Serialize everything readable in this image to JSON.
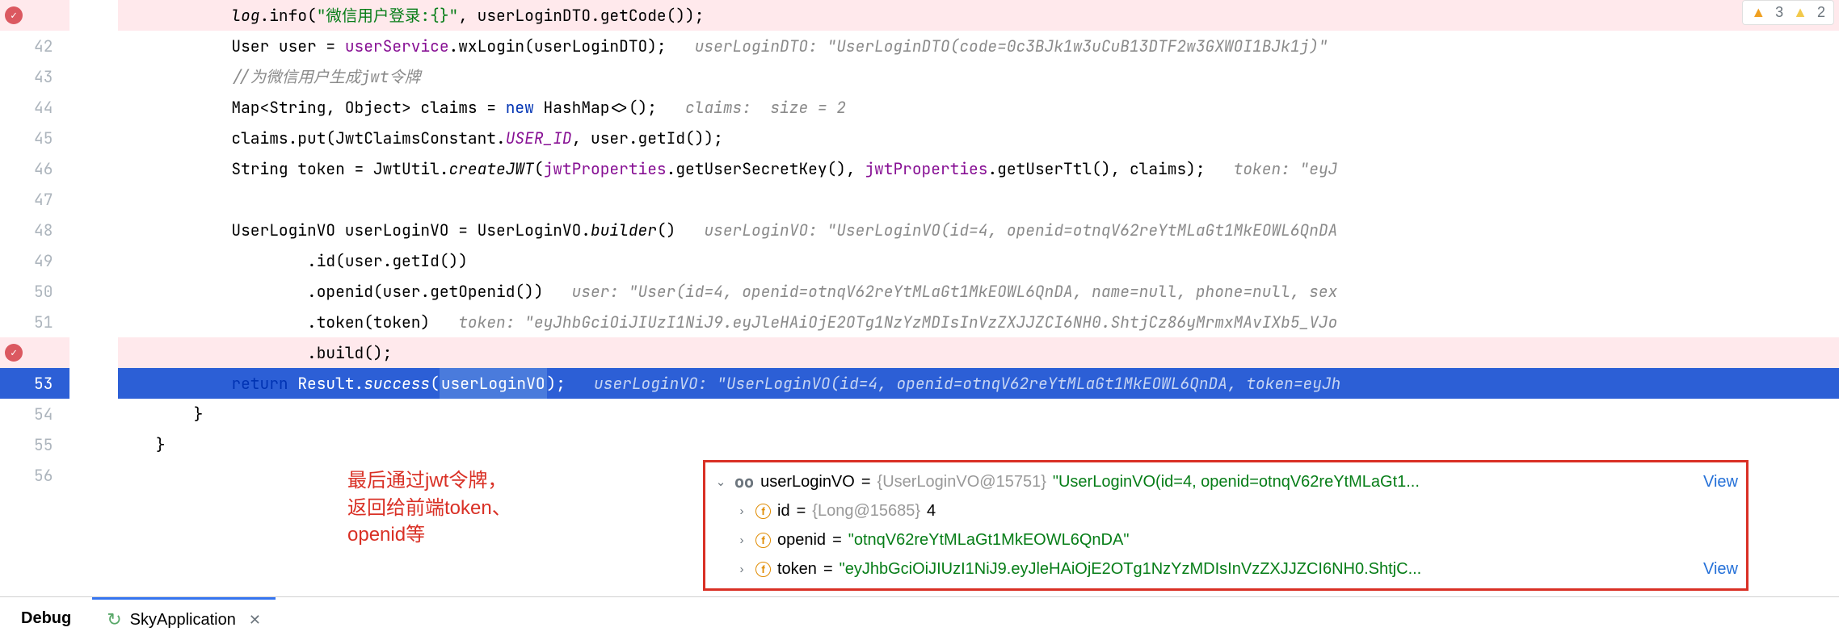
{
  "inspections": {
    "warn_count": "3",
    "weak_count": "2"
  },
  "lines": [
    {
      "num": "",
      "icon": "breakpoint",
      "indent": "            ",
      "tokens": [
        {
          "cls": "log-italic",
          "t": "log"
        },
        {
          "t": ".info("
        },
        {
          "cls": "str",
          "t": "\"微信用户登录:{}\""
        },
        {
          "t": ", userLoginDTO.getCode());"
        }
      ]
    },
    {
      "num": "42",
      "indent": "            ",
      "tokens": [
        {
          "t": "User user = "
        },
        {
          "cls": "field",
          "t": "userService"
        },
        {
          "t": ".wxLogin(userLoginDTO);   "
        },
        {
          "cls": "hint",
          "t": "userLoginDTO: \"UserLoginDTO(code=0c3BJk1w3uCuB13DTF2w3GXWOI1BJk1j)\""
        }
      ]
    },
    {
      "num": "43",
      "indent": "            ",
      "tokens": [
        {
          "cls": "comment",
          "t": "//为微信用户生成jwt令牌"
        }
      ]
    },
    {
      "num": "44",
      "indent": "            ",
      "tokens": [
        {
          "t": "Map<String, Object> claims = "
        },
        {
          "cls": "kw",
          "t": "new "
        },
        {
          "t": "HashMap<>();   "
        },
        {
          "cls": "hint",
          "t": "claims:  size = 2"
        }
      ]
    },
    {
      "num": "45",
      "indent": "            ",
      "tokens": [
        {
          "t": "claims.put(JwtClaimsConstant."
        },
        {
          "cls": "field method-static",
          "t": "USER_ID"
        },
        {
          "t": ", user.getId());"
        }
      ]
    },
    {
      "num": "46",
      "indent": "            ",
      "tokens": [
        {
          "t": "String token = JwtUtil."
        },
        {
          "cls": "method-static",
          "t": "createJWT"
        },
        {
          "t": "("
        },
        {
          "cls": "field",
          "t": "jwtProperties"
        },
        {
          "t": ".getUserSecretKey(), "
        },
        {
          "cls": "field",
          "t": "jwtProperties"
        },
        {
          "t": ".getUserTtl(), claims);   "
        },
        {
          "cls": "hint",
          "t": "token: \"eyJ"
        }
      ]
    },
    {
      "num": "47",
      "indent": "",
      "tokens": [
        {
          "t": ""
        }
      ]
    },
    {
      "num": "48",
      "indent": "            ",
      "tokens": [
        {
          "t": "UserLoginVO userLoginVO = UserLoginVO."
        },
        {
          "cls": "method-static",
          "t": "builder"
        },
        {
          "t": "()   "
        },
        {
          "cls": "hint",
          "t": "userLoginVO: \"UserLoginVO(id=4, openid=otnqV62reYtMLaGt1MkEOWL6QnDA"
        }
      ]
    },
    {
      "num": "49",
      "indent": "                    ",
      "tokens": [
        {
          "t": ".id(user.getId())"
        }
      ]
    },
    {
      "num": "50",
      "indent": "                    ",
      "tokens": [
        {
          "t": ".openid(user.getOpenid())   "
        },
        {
          "cls": "hint",
          "t": "user: \"User(id=4, openid=otnqV62reYtMLaGt1MkEOWL6QnDA, name=null, phone=null, sex"
        }
      ]
    },
    {
      "num": "51",
      "indent": "                    ",
      "tokens": [
        {
          "t": ".token(token)   "
        },
        {
          "cls": "hint",
          "t": "token: \"eyJhbGciOiJIUzI1NiJ9.eyJleHAiOjE2OTg1NzYzMDIsInVzZXJJZCI6NH0.ShtjCz86yMrmxMAvIXb5_VJo"
        }
      ]
    },
    {
      "num": "",
      "icon": "breakpoint",
      "indent": "                    ",
      "tokens": [
        {
          "t": ".build();"
        }
      ]
    },
    {
      "num": "53",
      "exec": true,
      "indent": "            ",
      "tokens": [
        {
          "cls": "kw",
          "t": "return "
        },
        {
          "t": "Result."
        },
        {
          "cls": "method-static",
          "t": "success"
        },
        {
          "t": "("
        },
        {
          "cls": "exec-hl",
          "t": "userLoginVO"
        },
        {
          "t": ");   "
        },
        {
          "cls": "hint",
          "t": "userLoginVO: \"UserLoginVO(id=4, openid=otnqV62reYtMLaGt1MkEOWL6QnDA, token=eyJh"
        }
      ]
    },
    {
      "num": "54",
      "indent": "        ",
      "tokens": [
        {
          "t": "}"
        }
      ]
    },
    {
      "num": "55",
      "indent": "    ",
      "tokens": [
        {
          "t": "}"
        }
      ]
    },
    {
      "num": "56",
      "indent": "",
      "tokens": [
        {
          "t": ""
        }
      ]
    }
  ],
  "annotation": {
    "l1": "最后通过jwt令牌，",
    "l2": "返回给前端token、",
    "l3": "openid等"
  },
  "popup": {
    "header_name": "userLoginVO",
    "header_type": "{UserLoginVO@15751}",
    "header_val": "\"UserLoginVO(id=4, openid=otnqV62reYtMLaGt1...",
    "view": "View",
    "fields": [
      {
        "name": "id",
        "type": "{Long@15685}",
        "val": "4",
        "is_str": false
      },
      {
        "name": "openid",
        "type": "",
        "val": "\"otnqV62reYtMLaGt1MkEOWL6QnDA\"",
        "is_str": true
      },
      {
        "name": "token",
        "type": "",
        "val": "\"eyJhbGciOiJIUzI1NiJ9.eyJleHAiOjE2OTg1NzYzMDIsInVzZXJJZCI6NH0.ShtjC...",
        "is_str": true,
        "view": true
      }
    ]
  },
  "tabs": {
    "debug": "Debug",
    "app": "SkyApplication"
  }
}
